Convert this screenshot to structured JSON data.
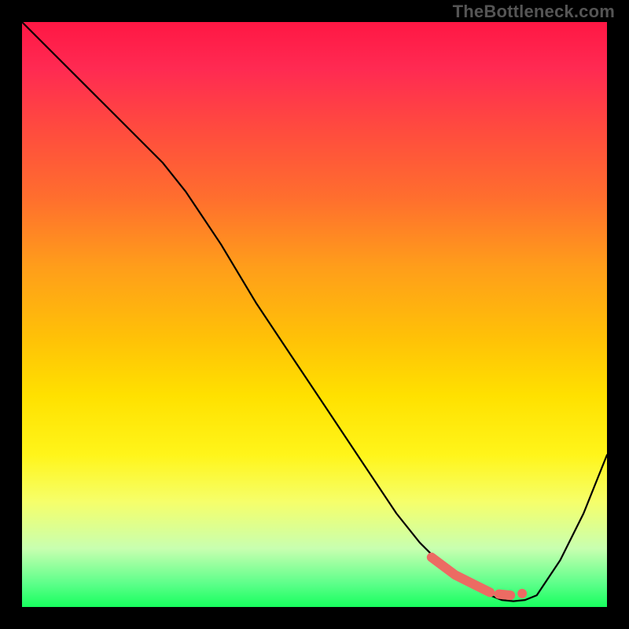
{
  "watermark": "TheBottleneck.com",
  "colors": {
    "highlight": "#ec6b63",
    "line": "#000000",
    "gradient_top": "#ff1744",
    "gradient_bottom": "#17ff5e"
  },
  "chart_data": {
    "type": "line",
    "title": "",
    "xlabel": "",
    "ylabel": "",
    "xlim": [
      0,
      100
    ],
    "ylim": [
      0,
      100
    ],
    "grid": false,
    "legend": false,
    "note": "Axes have no tick labels in the image; values below are estimated from pixel positions on a 0–100 normalized scale for each axis (0,0 at bottom-left). The curve descends from top-left to a trough near x≈82 then rises toward the right edge.",
    "series": [
      {
        "name": "curve",
        "x": [
          0,
          6,
          12,
          18,
          24,
          28,
          34,
          40,
          46,
          52,
          58,
          64,
          68,
          72,
          76,
          80,
          82,
          84,
          86,
          88,
          92,
          96,
          100
        ],
        "y": [
          100,
          94,
          88,
          82,
          76,
          71,
          62,
          52,
          43,
          34,
          25,
          16,
          11,
          7,
          4,
          2,
          1.2,
          1.0,
          1.2,
          2,
          8,
          16,
          26
        ]
      }
    ],
    "highlight_segment": {
      "description": "Thick salmon-colored stroke along the curve near its minimum, roughly x≈70–86, split into an L-shaped piece plus a short dash and a dot.",
      "x_range": [
        70,
        86
      ],
      "pieces": [
        {
          "kind": "path",
          "x": [
            70,
            74,
            78,
            80
          ],
          "y": [
            8.5,
            5.5,
            3.5,
            2.5
          ]
        },
        {
          "kind": "dash",
          "x": [
            81.5,
            83.5
          ],
          "y": [
            2.2,
            2.0
          ]
        },
        {
          "kind": "dot",
          "x": 85.5,
          "y": 2.3
        }
      ]
    }
  }
}
